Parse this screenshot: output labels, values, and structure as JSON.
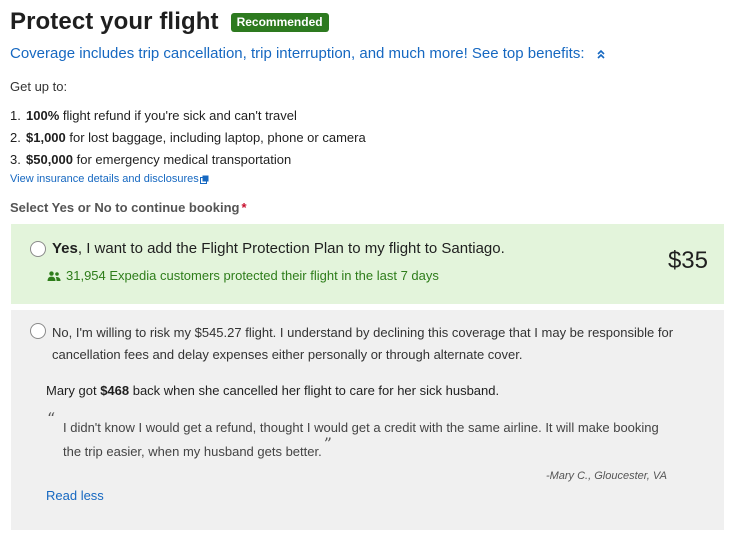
{
  "header": {
    "title": "Protect your flight",
    "badge": "Recommended"
  },
  "coverage": {
    "text": "Coverage includes trip cancellation, trip interruption, and much more! See top benefits:",
    "toggle_icon": "chevron-up-icon"
  },
  "get_up_to": "Get up to:",
  "benefits": [
    {
      "num": "1.",
      "amount": "100%",
      "text": " flight refund if you're sick and can't travel"
    },
    {
      "num": "2.",
      "amount": "$1,000",
      "text": " for lost baggage, including laptop, phone or camera"
    },
    {
      "num": "3.",
      "amount": "$50,000",
      "text": " for emergency medical transportation"
    }
  ],
  "details_link": "View insurance details and disclosures",
  "select_prompt": {
    "label": "Select Yes or No to continue booking",
    "asterisk": "*"
  },
  "option_yes": {
    "strong": "Yes",
    "text": ", I want to add the Flight Protection Plan to my flight to Santiago.",
    "social_proof": "31,954 Expedia customers protected their flight in the last 7 days",
    "price": "$35",
    "selected": false
  },
  "option_no": {
    "text": "No, I'm willing to risk my $545.27 flight. I understand by declining this coverage that I may be responsible for cancellation fees and delay expenses either personally or through alternate cover.",
    "selected": false,
    "story_pre": "Mary got ",
    "story_amount": "$468",
    "story_post": " back when she cancelled her flight to care for her sick husband.",
    "open_quote": "“",
    "quote": "I didn't know I would get a refund, thought I would get a credit with the same airline. It will make booking the trip easier, when my husband gets better.",
    "close_quote": "”",
    "attribution": "-Mary C., Gloucester, VA",
    "read_less": "Read less"
  },
  "colors": {
    "link": "#1668c1",
    "badge": "#2d7a1f",
    "yes_bg": "#e3f4db",
    "no_bg": "#f0f0f0",
    "success_text": "#2e7d1a",
    "required": "#c8102e"
  }
}
